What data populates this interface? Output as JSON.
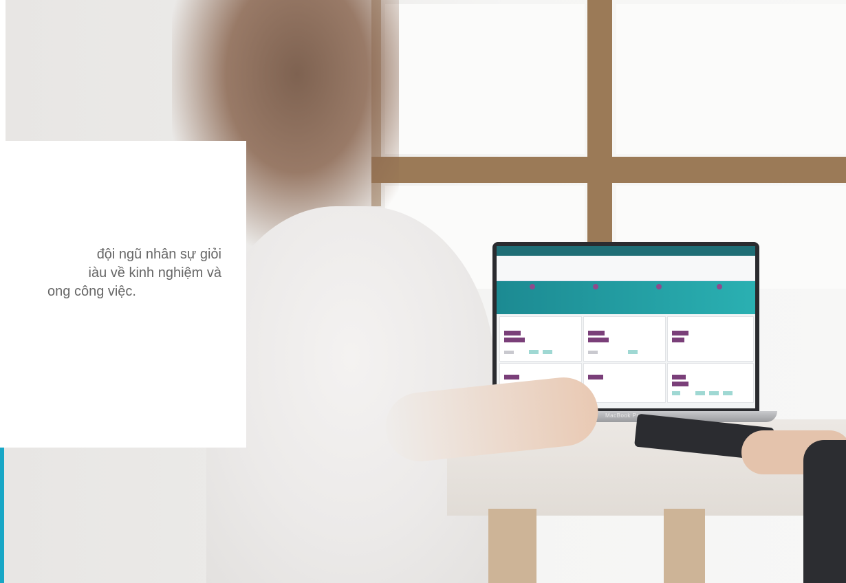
{
  "info_card": {
    "lines": [
      "đội ngũ nhân sự giỏi",
      "iàu về kinh nghiệm và",
      "ong công việc."
    ]
  },
  "laptop": {
    "brand": "MacBook Pro"
  },
  "colors": {
    "accent": "#18a7c6",
    "text": "#666666",
    "card": "#ffffff"
  }
}
